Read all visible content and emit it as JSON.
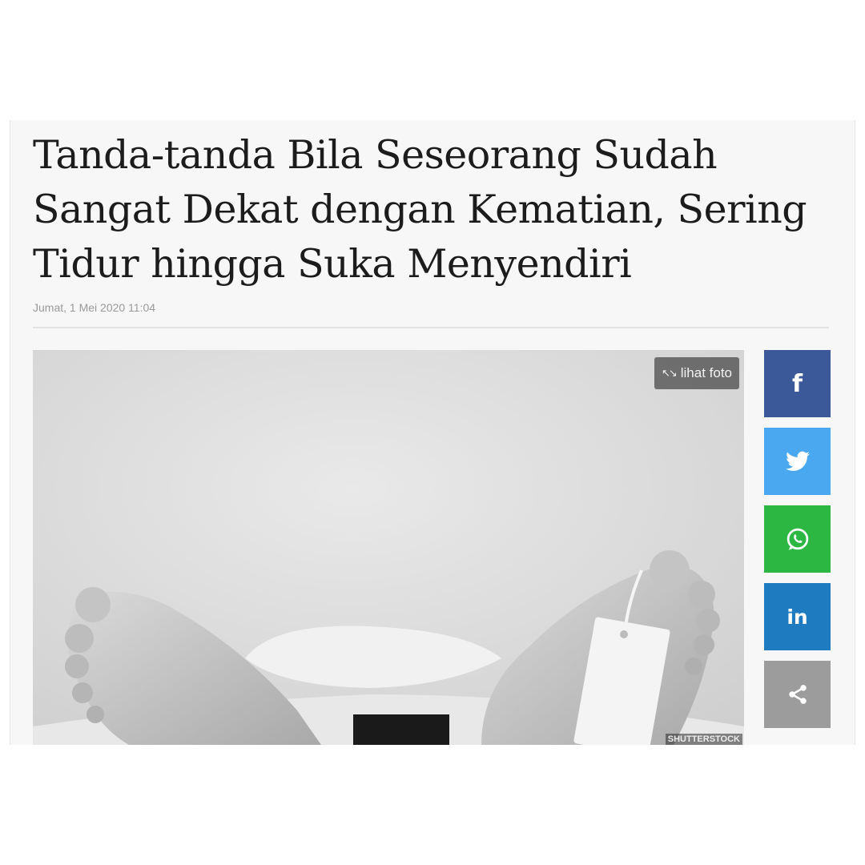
{
  "article": {
    "title_lines": [
      "Tanda-tanda Bila Seseorang Sudah",
      "Sangat Dekat dengan Kematian, Sering",
      "Tidur hingga Suka Menyendiri"
    ],
    "date": "Jumat, 1 Mei 2020 11:04"
  },
  "photo": {
    "view_label": "lihat foto",
    "view_icon": "expand-icon",
    "credit": "SHUTTERSTOCK"
  },
  "share": [
    {
      "name": "facebook",
      "icon": "facebook-icon",
      "color": "#3b5998"
    },
    {
      "name": "twitter",
      "icon": "twitter-icon",
      "color": "#4aa8f0"
    },
    {
      "name": "whatsapp",
      "icon": "whatsapp-icon",
      "color": "#2bb741"
    },
    {
      "name": "linkedin",
      "icon": "linkedin-icon",
      "color": "#1f7bbf"
    },
    {
      "name": "share",
      "icon": "share-icon",
      "color": "#9c9c9c"
    }
  ]
}
